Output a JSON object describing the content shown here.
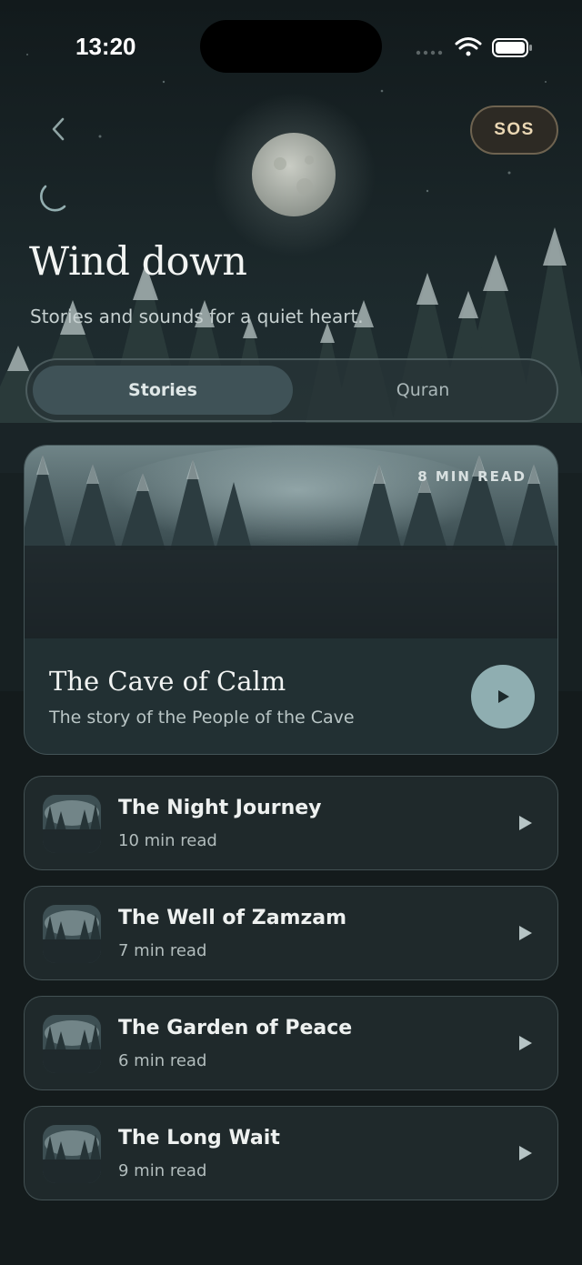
{
  "status_bar": {
    "time": "13:20"
  },
  "header": {
    "sos_label": "SOS",
    "title": "Wind down",
    "subtitle": "Stories and sounds for a quiet heart."
  },
  "tabs": [
    {
      "label": "Stories",
      "selected": true
    },
    {
      "label": "Quran",
      "selected": false
    }
  ],
  "featured": {
    "badge": "8 MIN READ",
    "title": "The Cave of Calm",
    "subtitle": "The story of the People of the Cave"
  },
  "stories": [
    {
      "title": "The Night Journey",
      "meta": "10 min read"
    },
    {
      "title": "The Well of Zamzam",
      "meta": "7 min read"
    },
    {
      "title": "The Garden of Peace",
      "meta": "6 min read"
    },
    {
      "title": "The Long Wait",
      "meta": "9 min read"
    }
  ],
  "colors": {
    "accent": "#8faeb1",
    "sos_text": "#ead7b4",
    "background": "#141b1c"
  }
}
